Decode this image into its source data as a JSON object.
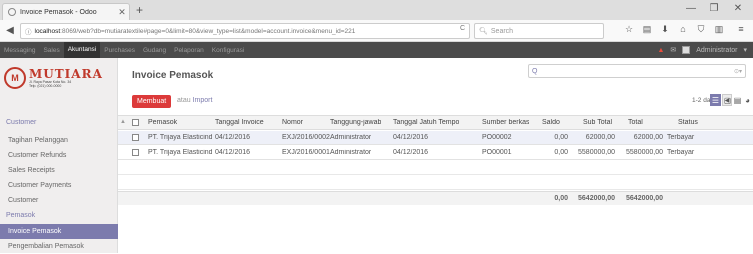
{
  "browser": {
    "tab_title": "Invoice Pemasok - Odoo",
    "tab_close": "✕",
    "new_tab": "+",
    "url_host": "localhost",
    "url_rest": ":8069/web?db=mutiaratextile#page=0&limit=80&view_type=list&model=account.invoice&menu_id=221",
    "reload": "C",
    "search_placeholder": "Search"
  },
  "topmenu": {
    "items": [
      "Messaging",
      "Sales",
      "Akuntansi",
      "Purchases",
      "Gudang",
      "Pelaporan",
      "Konfigurasi"
    ],
    "active": "Akuntansi",
    "user": "Administrator"
  },
  "logo": {
    "mark": "M",
    "name": "MUTIARA",
    "line1": "Jl. Raya Pasar Kota No. 34",
    "line2": "Telp. (021) 000-0000"
  },
  "sidebar": {
    "section1": "Customer",
    "items1": [
      "Tagihan Pelanggan",
      "Customer Refunds",
      "Sales Receipts",
      "Customer Payments",
      "Customer"
    ],
    "section2": "Pemasok",
    "items2": [
      "Invoice Pemasok",
      "Pengembalian Pemasok"
    ],
    "selected": "Invoice Pemasok"
  },
  "main": {
    "title": "Invoice Pemasok",
    "create_label": "Membuat",
    "or_label": "atau",
    "import_label": "Import",
    "search_value": "Q",
    "pager": "1-2 dari 2"
  },
  "table": {
    "columns": [
      "Pemasok",
      "Tanggal Invoice",
      "Nomor",
      "Tanggung-jawab",
      "Tanggal Jatuh Tempo",
      "Sumber berkas",
      "Saldo",
      "Sub Total",
      "Total",
      "Status"
    ],
    "rows": [
      [
        "PT. Trijaya Elasticindo",
        "04/12/2016",
        "EXJ/2016/0002",
        "Administrator",
        "04/12/2016",
        "PO00002",
        "0,00",
        "62000,00",
        "62000,00",
        "Terbayar"
      ],
      [
        "PT. Trijaya Elasticindo",
        "04/12/2016",
        "EXJ/2016/0001",
        "Administrator",
        "04/12/2016",
        "PO00001",
        "0,00",
        "5580000,00",
        "5580000,00",
        "Terbayar"
      ]
    ],
    "totals": {
      "saldo": "0,00",
      "subtotal": "5642000,00",
      "total": "5642000,00"
    }
  }
}
